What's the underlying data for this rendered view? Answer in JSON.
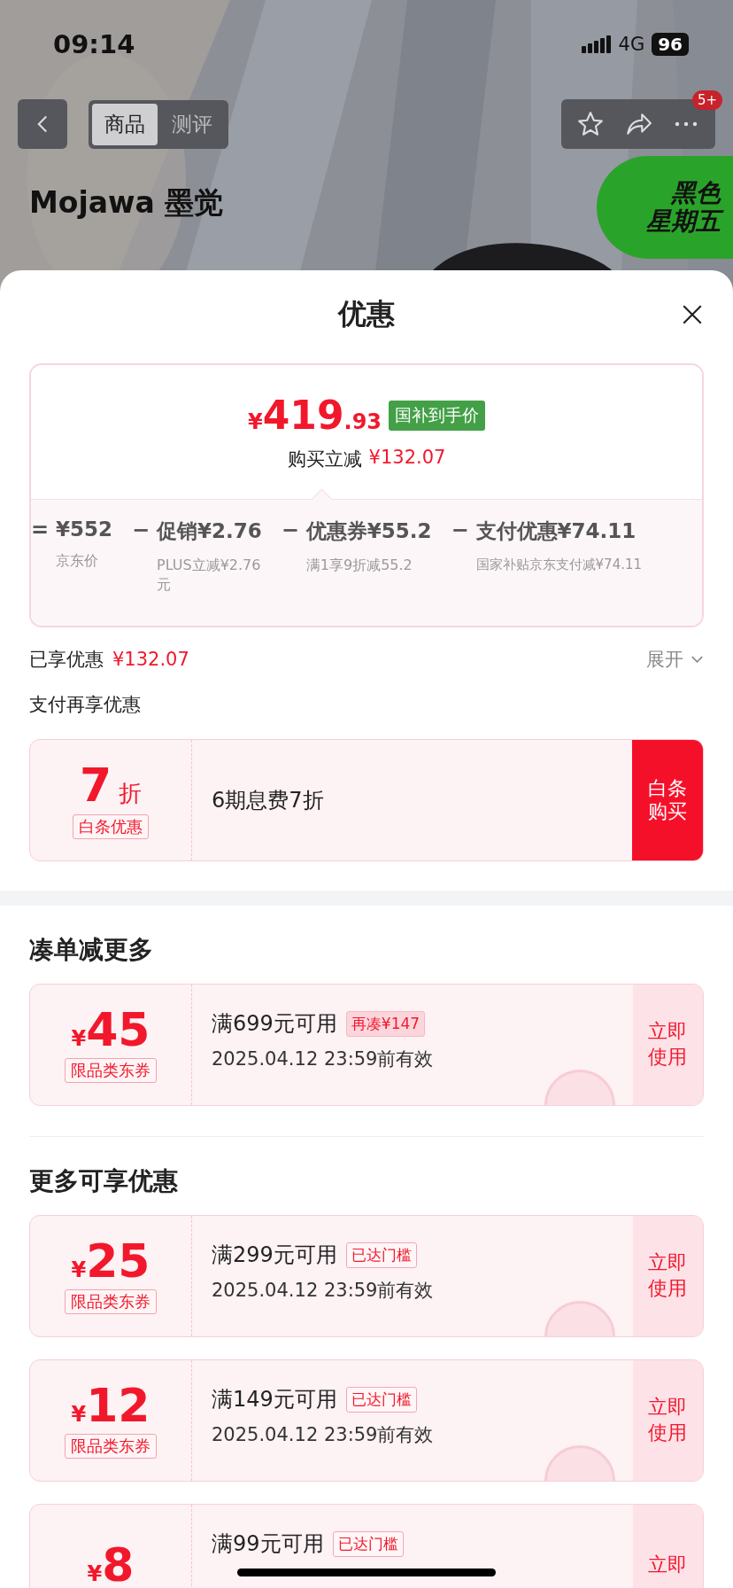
{
  "status_bar": {
    "time": "09:14",
    "network": "4G",
    "battery": "96"
  },
  "nav": {
    "tabs": [
      {
        "label": "商品",
        "selected": true
      },
      {
        "label": "测评",
        "selected": false
      }
    ],
    "badge": "5+"
  },
  "banner": {
    "brand": "Mojawa 墨觉",
    "promo_lines": [
      "黑色",
      "星期五"
    ]
  },
  "sheet": {
    "title": "优惠"
  },
  "price_card": {
    "currency": "¥",
    "price_int": "419",
    "price_dec": ".93",
    "price_tag": "国补到手价",
    "saving_label": "购买立减",
    "saving": "¥132.07",
    "breakdown": [
      {
        "operator": "=",
        "amount": "¥552",
        "note": "京东价"
      },
      {
        "operator": "−",
        "amount": "促销¥2.76",
        "note": "PLUS立减¥2.76元"
      },
      {
        "operator": "−",
        "amount": "优惠券¥55.2",
        "note": "满1享9折减55.2"
      },
      {
        "operator": "−",
        "amount": "支付优惠¥74.11",
        "note": "国家补贴京东支付减¥74.11"
      }
    ]
  },
  "enjoyed": {
    "label": "已享优惠",
    "amount": "¥132.07",
    "expand": "展开"
  },
  "pay_more": {
    "title": "支付再享优惠",
    "value": "7",
    "unit": "折",
    "tag": "白条优惠",
    "text": "6期息费7折",
    "button": "白条购买"
  },
  "sections": [
    {
      "title": "凑单减更多",
      "coupons": [
        {
          "currency": "¥",
          "amount": "45",
          "label": "限品类东券",
          "condition": "满699元可用",
          "tag": "再凑¥147",
          "kind": "shortfall",
          "expiry": "2025.04.12 23:59前有效",
          "claimed": true,
          "action": "立即使用"
        }
      ]
    },
    {
      "title": "更多可享优惠",
      "coupons": [
        {
          "currency": "¥",
          "amount": "25",
          "label": "限品类东券",
          "condition": "满299元可用",
          "tag": "已达门槛",
          "kind": "reached",
          "expiry": "2025.04.12 23:59前有效",
          "claimed": true,
          "action": "立即使用"
        },
        {
          "currency": "¥",
          "amount": "12",
          "label": "限品类东券",
          "condition": "满149元可用",
          "tag": "已达门槛",
          "kind": "reached",
          "expiry": "2025.04.12 23:59前有效",
          "claimed": true,
          "action": "立即使用"
        },
        {
          "currency": "¥",
          "amount": "8",
          "condition": "满99元可用",
          "tag": "已达门槛",
          "kind": "reached",
          "action": "立即"
        }
      ]
    }
  ]
}
